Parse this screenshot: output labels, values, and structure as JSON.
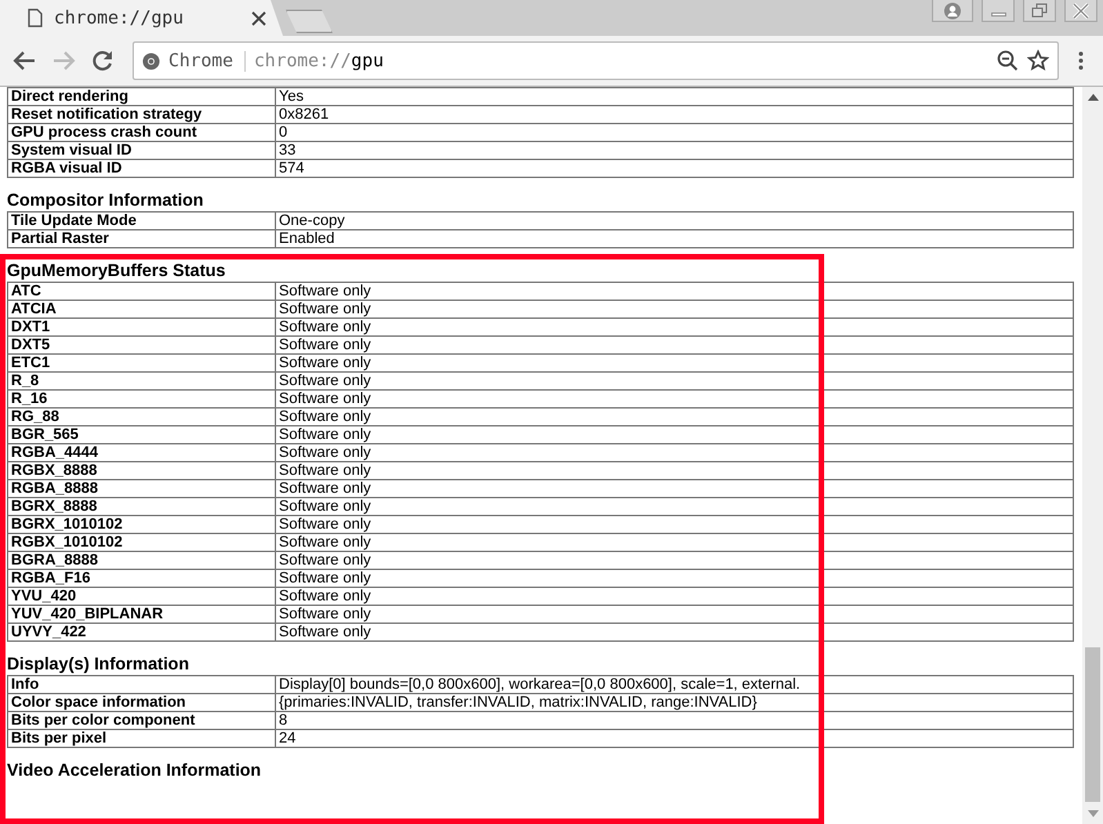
{
  "tab": {
    "title": "chrome://gpu"
  },
  "omnibox": {
    "origin_label": "Chrome",
    "url_scheme": "chrome://",
    "url_host": "gpu"
  },
  "sections": [
    {
      "rows": [
        {
          "label": "Direct rendering",
          "value": "Yes"
        },
        {
          "label": "Reset notification strategy",
          "value": "0x8261"
        },
        {
          "label": "GPU process crash count",
          "value": "0"
        },
        {
          "label": "System visual ID",
          "value": "33"
        },
        {
          "label": "RGBA visual ID",
          "value": "574"
        }
      ]
    },
    {
      "title": "Compositor Information",
      "rows": [
        {
          "label": "Tile Update Mode",
          "value": "One-copy"
        },
        {
          "label": "Partial Raster",
          "value": "Enabled"
        }
      ]
    },
    {
      "title": "GpuMemoryBuffers Status",
      "rows": [
        {
          "label": "ATC",
          "value": "Software only"
        },
        {
          "label": "ATCIA",
          "value": "Software only"
        },
        {
          "label": "DXT1",
          "value": "Software only"
        },
        {
          "label": "DXT5",
          "value": "Software only"
        },
        {
          "label": "ETC1",
          "value": "Software only"
        },
        {
          "label": "R_8",
          "value": "Software only"
        },
        {
          "label": "R_16",
          "value": "Software only"
        },
        {
          "label": "RG_88",
          "value": "Software only"
        },
        {
          "label": "BGR_565",
          "value": "Software only"
        },
        {
          "label": "RGBA_4444",
          "value": "Software only"
        },
        {
          "label": "RGBX_8888",
          "value": "Software only"
        },
        {
          "label": "RGBA_8888",
          "value": "Software only"
        },
        {
          "label": "BGRX_8888",
          "value": "Software only"
        },
        {
          "label": "BGRX_1010102",
          "value": "Software only"
        },
        {
          "label": "RGBX_1010102",
          "value": "Software only"
        },
        {
          "label": "BGRA_8888",
          "value": "Software only"
        },
        {
          "label": "RGBA_F16",
          "value": "Software only"
        },
        {
          "label": "YVU_420",
          "value": "Software only"
        },
        {
          "label": "YUV_420_BIPLANAR",
          "value": "Software only"
        },
        {
          "label": "UYVY_422",
          "value": "Software only"
        }
      ]
    },
    {
      "title": "Display(s) Information",
      "rows": [
        {
          "label": "Info",
          "value": "Display[0] bounds=[0,0 800x600], workarea=[0,0 800x600], scale=1, external."
        },
        {
          "label": "Color space information",
          "value": "{primaries:INVALID, transfer:INVALID, matrix:INVALID, range:INVALID}"
        },
        {
          "label": "Bits per color component",
          "value": "8"
        },
        {
          "label": "Bits per pixel",
          "value": "24"
        }
      ]
    },
    {
      "title": "Video Acceleration Information"
    }
  ]
}
